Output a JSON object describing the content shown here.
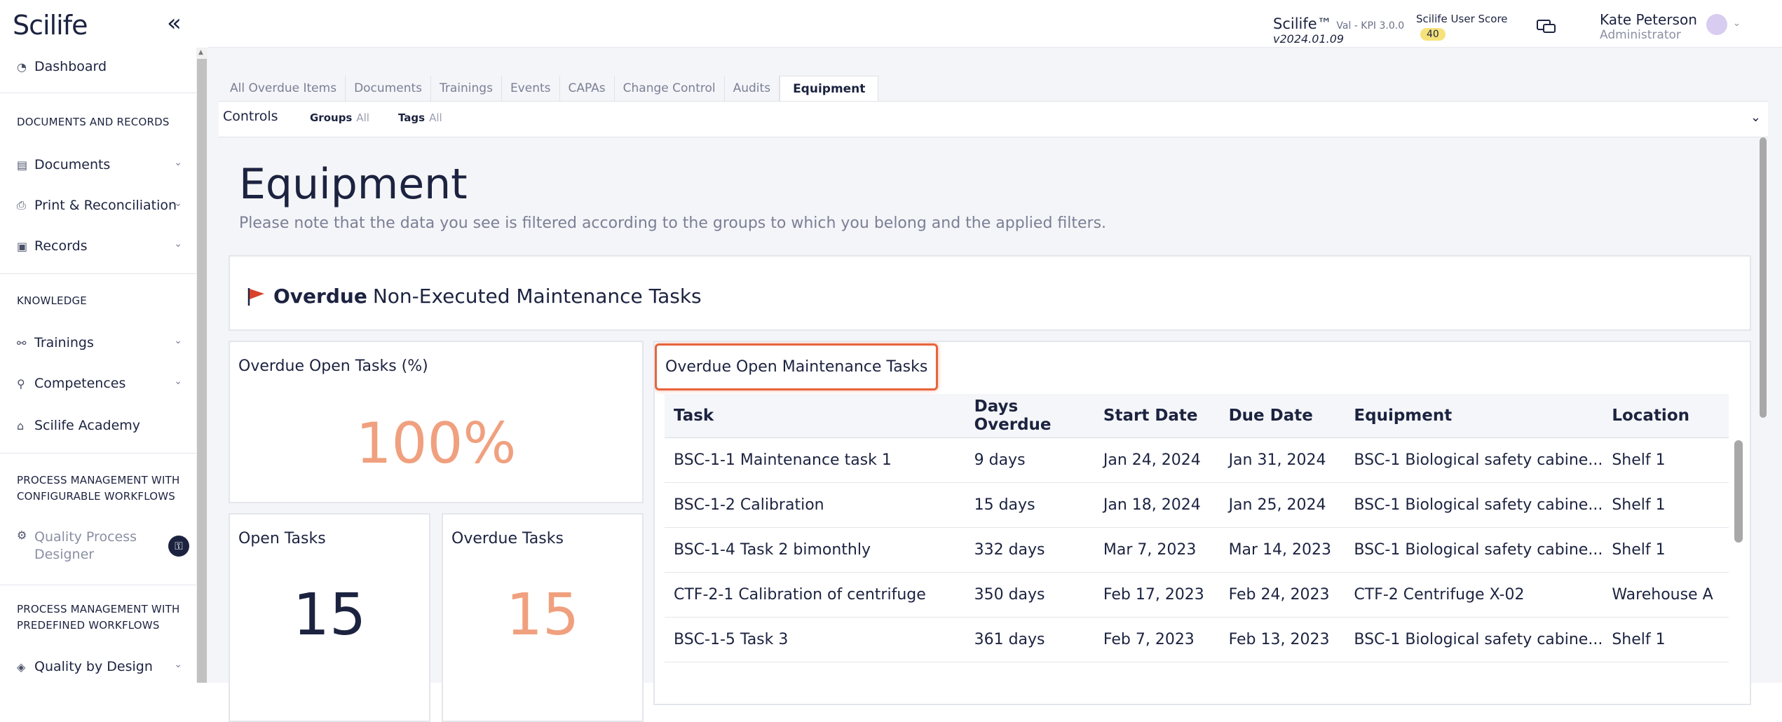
{
  "sidebar": {
    "logo": "Scilife",
    "dashboard": "Dashboard",
    "section_docs": "DOCUMENTS AND RECORDS",
    "documents": "Documents",
    "print": "Print & Reconciliation",
    "records": "Records",
    "section_knowledge": "KNOWLEDGE",
    "trainings": "Trainings",
    "competences": "Competences",
    "academy": "Scilife Academy",
    "section_configurable_1": "PROCESS MANAGEMENT WITH",
    "section_configurable_2": "CONFIGURABLE WORKFLOWS",
    "qpd_1": "Quality Process",
    "qpd_2": "Designer",
    "section_predefined_1": "PROCESS MANAGEMENT WITH",
    "section_predefined_2": "PREDEFINED WORKFLOWS",
    "qbd": "Quality by Design"
  },
  "header": {
    "product": "Scilife™",
    "product_sub": "Val - KPI 3.0.0",
    "version": "v2024.01.09",
    "score_label": "Scilife User Score",
    "score": "40",
    "user_name": "Kate Peterson",
    "user_role": "Administrator"
  },
  "tabs": [
    "All Overdue Items",
    "Documents",
    "Trainings",
    "Events",
    "CAPAs",
    "Change Control",
    "Audits",
    "Equipment"
  ],
  "controls": {
    "label": "Controls",
    "groups_label": "Groups",
    "groups_value": "All",
    "tags_label": "Tags",
    "tags_value": "All"
  },
  "page": {
    "title": "Equipment",
    "note": "Please note that the data you see is filtered according to the groups to which you belong and the applied filters.",
    "section_bold": "Overdue",
    "section_rest": "Non-Executed Maintenance Tasks"
  },
  "kpis": {
    "pct_label": "Overdue Open Tasks (%)",
    "pct_value": "100%",
    "open_label": "Open Tasks",
    "open_value": "15",
    "overdue_label": "Overdue Tasks",
    "overdue_value": "15"
  },
  "table": {
    "title": "Overdue Open Maintenance Tasks",
    "columns": [
      "Task",
      "Days Overdue",
      "Start Date",
      "Due Date",
      "Equipment",
      "Location"
    ],
    "rows": [
      [
        "BSC-1-1 Maintenance task 1",
        "9 days",
        "Jan 24, 2024",
        "Jan 31, 2024",
        "BSC-1 Biological safety cabine...",
        "Shelf 1"
      ],
      [
        "BSC-1-2 Calibration",
        "15 days",
        "Jan 18, 2024",
        "Jan 25, 2024",
        "BSC-1 Biological safety cabine...",
        "Shelf 1"
      ],
      [
        "BSC-1-4 Task 2 bimonthly",
        "332 days",
        "Mar 7, 2023",
        "Mar 14, 2023",
        "BSC-1 Biological safety cabine...",
        "Shelf 1"
      ],
      [
        "CTF-2-1 Calibration of centrifuge",
        "350 days",
        "Feb 17, 2023",
        "Feb 24, 2023",
        "CTF-2 Centrifuge X-02",
        "Warehouse A"
      ],
      [
        "BSC-1-5 Task 3",
        "361 days",
        "Feb 7, 2023",
        "Feb 13, 2023",
        "BSC-1 Biological safety cabine...",
        "Shelf 1"
      ]
    ]
  },
  "colors": {
    "accent_orange": "#f0a07e",
    "navy": "#1c2340",
    "highlight": "#e8643c",
    "flag": "#d9412b"
  }
}
